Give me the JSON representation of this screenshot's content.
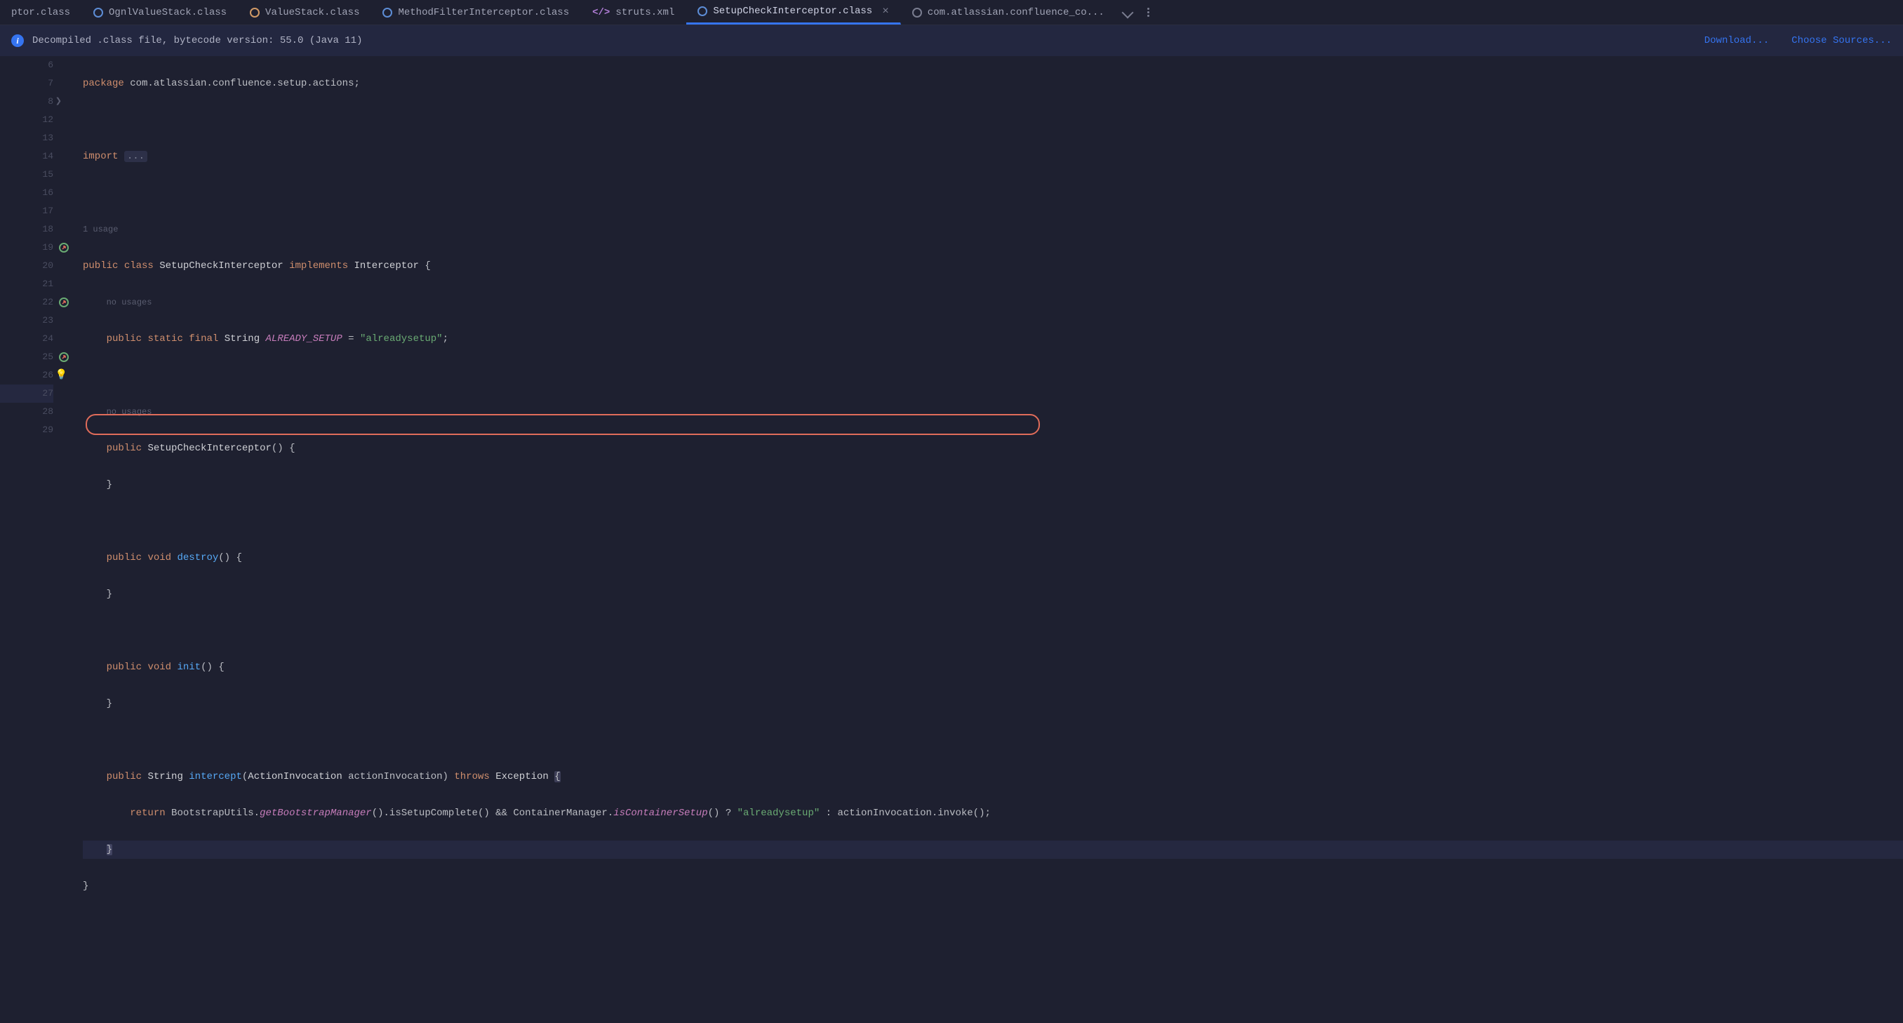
{
  "tabs": [
    {
      "label": "ptor.class",
      "icon": "class-purple",
      "active": false
    },
    {
      "label": "OgnlValueStack.class",
      "icon": "class-purple",
      "active": false
    },
    {
      "label": "ValueStack.class",
      "icon": "class-orange",
      "active": false
    },
    {
      "label": "MethodFilterInterceptor.class",
      "icon": "class-purple",
      "active": false
    },
    {
      "label": "struts.xml",
      "icon": "xml",
      "active": false
    },
    {
      "label": "SetupCheckInterceptor.class",
      "icon": "class-purple",
      "active": true
    },
    {
      "label": "com.atlassian.confluence_co...",
      "icon": "class-gray",
      "active": false
    }
  ],
  "banner": {
    "text": "Decompiled .class file, bytecode version: 55.0 (Java 11)",
    "link_download": "Download...",
    "link_choose": "Choose Sources..."
  },
  "gutter": {
    "line_numbers": [
      "6",
      "7",
      "8",
      "12",
      "",
      "13",
      "",
      "14",
      "15",
      "",
      "16",
      "17",
      "18",
      "19",
      "20",
      "21",
      "22",
      "23",
      "24",
      "25",
      "26",
      "27",
      "28",
      "29"
    ],
    "fold_lines": [
      "8"
    ],
    "override_lines": [
      "19",
      "22",
      "25"
    ],
    "bulb_lines": [
      "26"
    ]
  },
  "code": {
    "l6_pkg": "package",
    "l6_pkgname": "com.atlassian.confluence.setup.actions;",
    "l8_import": "import",
    "l8_dots": "...",
    "l12_usage": "1 usage",
    "l13_public": "public",
    "l13_class": "class",
    "l13_name": "SetupCheckInterceptor",
    "l13_implements": "implements",
    "l13_iface": "Interceptor",
    "l13b_nousages": "no usages",
    "l14_public": "public",
    "l14_static": "static",
    "l14_final": "final",
    "l14_string": "String",
    "l14_field": "ALREADY_SETUP",
    "l14_eq": " = ",
    "l14_str": "\"alreadysetup\"",
    "l15b_nousages": "no usages",
    "l16_public": "public",
    "l16_ctor": "SetupCheckInterceptor",
    "l19_public": "public",
    "l19_void": "void",
    "l19_destroy": "destroy",
    "l22_public": "public",
    "l22_void": "void",
    "l22_init": "init",
    "l25_public": "public",
    "l25_string": "String",
    "l25_method": "intercept",
    "l25_paramtype": "ActionInvocation",
    "l25_paramname": "actionInvocation",
    "l25_throws": "throws",
    "l25_exc": "Exception",
    "l26_return": "return",
    "l26_boot": "BootstrapUtils.",
    "l26_getboot": "getBootstrapManager",
    "l26_issetup": "().isSetupComplete() && ContainerManager.",
    "l26_iscontainer": "isContainerSetup",
    "l26_after": "() ? ",
    "l26_str": "\"alreadysetup\"",
    "l26_invoke": " : actionInvocation.invoke();"
  }
}
